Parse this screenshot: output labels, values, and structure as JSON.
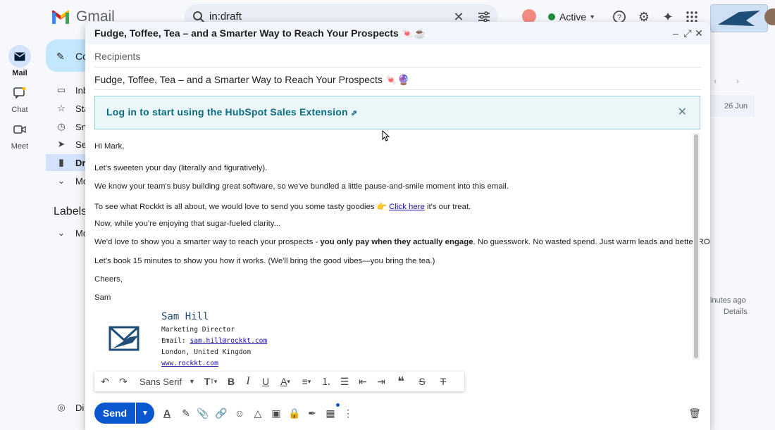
{
  "topbar": {
    "app_name": "Gmail",
    "search_value": "in:draft",
    "status_label": "Active"
  },
  "rail": {
    "items": [
      {
        "label": "Mail"
      },
      {
        "label": "Chat"
      },
      {
        "label": "Meet"
      }
    ]
  },
  "nav": {
    "compose_label": "Co",
    "items": [
      {
        "label": "Inb",
        "icon": "inbox-icon"
      },
      {
        "label": "Sta",
        "icon": "star-icon"
      },
      {
        "label": "Sno",
        "icon": "clock-icon"
      },
      {
        "label": "Sen",
        "icon": "send-icon"
      },
      {
        "label": "Dra",
        "icon": "draft-icon"
      },
      {
        "label": "Mo",
        "icon": "chevron-down-icon"
      }
    ],
    "labels_heading": "Labels",
    "labels_more": "Mo",
    "bottom_item": "Di"
  },
  "background_list": {
    "date": "26 Jun",
    "time_ago": "inutes ago",
    "details": "Details"
  },
  "compose": {
    "title": "Fudge, Toffee, Tea – and a Smarter Way to Reach Your Prospects 🍬☕",
    "recipients_placeholder": "Recipients",
    "subject": "Fudge, Toffee, Tea – and a Smarter Way to Reach Your Prospects 🍬🔮",
    "hubspot_banner": "Log in to start using the HubSpot Sales Extension",
    "body": {
      "greeting": "Hi Mark,",
      "p1": "Let's sweeten your day (literally and figuratively).",
      "p2": "We know your team's busy building great software, so we've bundled a little pause-and-smile moment into this email.",
      "p3_a": "To see what Rockkt is all about, we would love to send you some tasty goodies 👉",
      "p3_link": "Click here",
      "p3_b": "it's our treat.",
      "p4": "Now, while you're enjoying that sugar-fueled clarity...",
      "p5_a": "We'd love to show you a smarter way to reach your prospects -",
      "p5_bold": "you only pay when they actually engage",
      "p5_b": ". No guesswork. No wasted spend. Just warm leads and better ROI.",
      "p6": "Let's book 15 minutes to show you how it works. (We'll bring the good vibes—you bring the tea.)",
      "closing": "Cheers,",
      "sender": "Sam"
    },
    "signature": {
      "name": "Sam Hill",
      "title": "Marketing Director",
      "email_label": "Email:",
      "email": "sam.hill@rockkt.com",
      "location": "London, United Kingdom",
      "website": "www.rockkt.com"
    },
    "format_bar": {
      "font": "Sans Serif"
    },
    "send_label": "Send"
  }
}
